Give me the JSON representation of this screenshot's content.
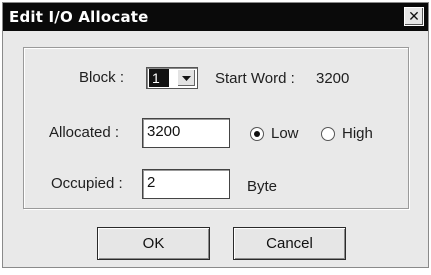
{
  "dialog": {
    "title": "Edit I/O Allocate",
    "close_glyph": "✕"
  },
  "block": {
    "label": "Block :",
    "value": "1",
    "dropdown_icon": "chevron-down-icon"
  },
  "start_word": {
    "label": "Start Word :",
    "value": "3200"
  },
  "allocated": {
    "label": "Allocated :",
    "value": "3200",
    "options": [
      {
        "label": "Low",
        "selected": true
      },
      {
        "label": "High",
        "selected": false
      }
    ]
  },
  "occupied": {
    "label": "Occupied :",
    "value": "2",
    "unit": "Byte"
  },
  "buttons": {
    "ok": "OK",
    "cancel": "Cancel"
  }
}
